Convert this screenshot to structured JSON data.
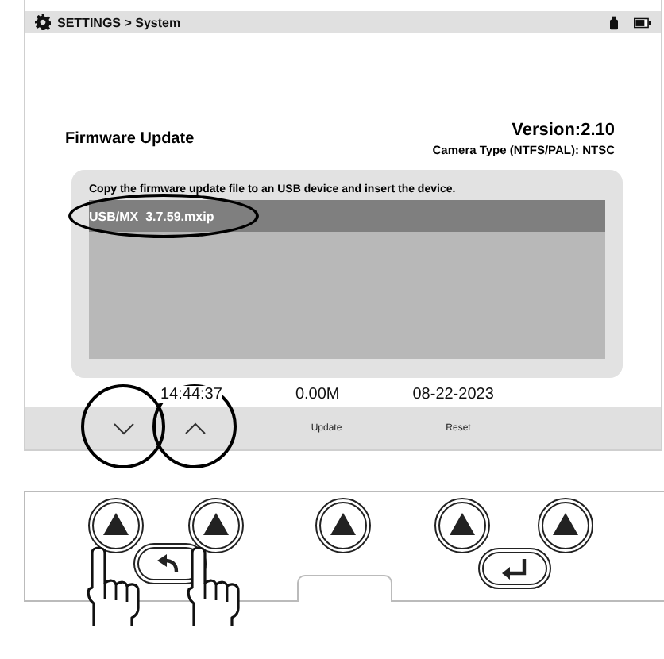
{
  "title_bar": {
    "title": "SETTINGS > System"
  },
  "heading": "Firmware Update",
  "version": "Version:2.10",
  "camera_type": "Camera Type (NTFS/PAL): NTSC",
  "instruction": "Copy the firmware update file to an USB device and insert the device.",
  "files": [
    {
      "name": "USB/MX_3.7.59.mxip",
      "selected": true,
      "circled": true
    }
  ],
  "status": {
    "time": "14:44:37",
    "size": "0.00M",
    "date": "08-22-2023"
  },
  "softkeys": [
    {
      "kind": "down",
      "circled": true
    },
    {
      "kind": "up",
      "circled": true
    },
    {
      "kind": "label",
      "label": "Update",
      "circled": false
    },
    {
      "kind": "label",
      "label": "Reset",
      "circled": false
    }
  ],
  "keys": [
    {
      "kind": "arrow",
      "pressed": true
    },
    {
      "kind": "arrow",
      "pressed": true
    },
    {
      "kind": "arrow",
      "pressed": false
    },
    {
      "kind": "arrow",
      "pressed": false
    },
    {
      "kind": "arrow",
      "pressed": false
    }
  ],
  "lower_keys": [
    {
      "kind": "back"
    },
    {
      "kind": "enter"
    }
  ]
}
